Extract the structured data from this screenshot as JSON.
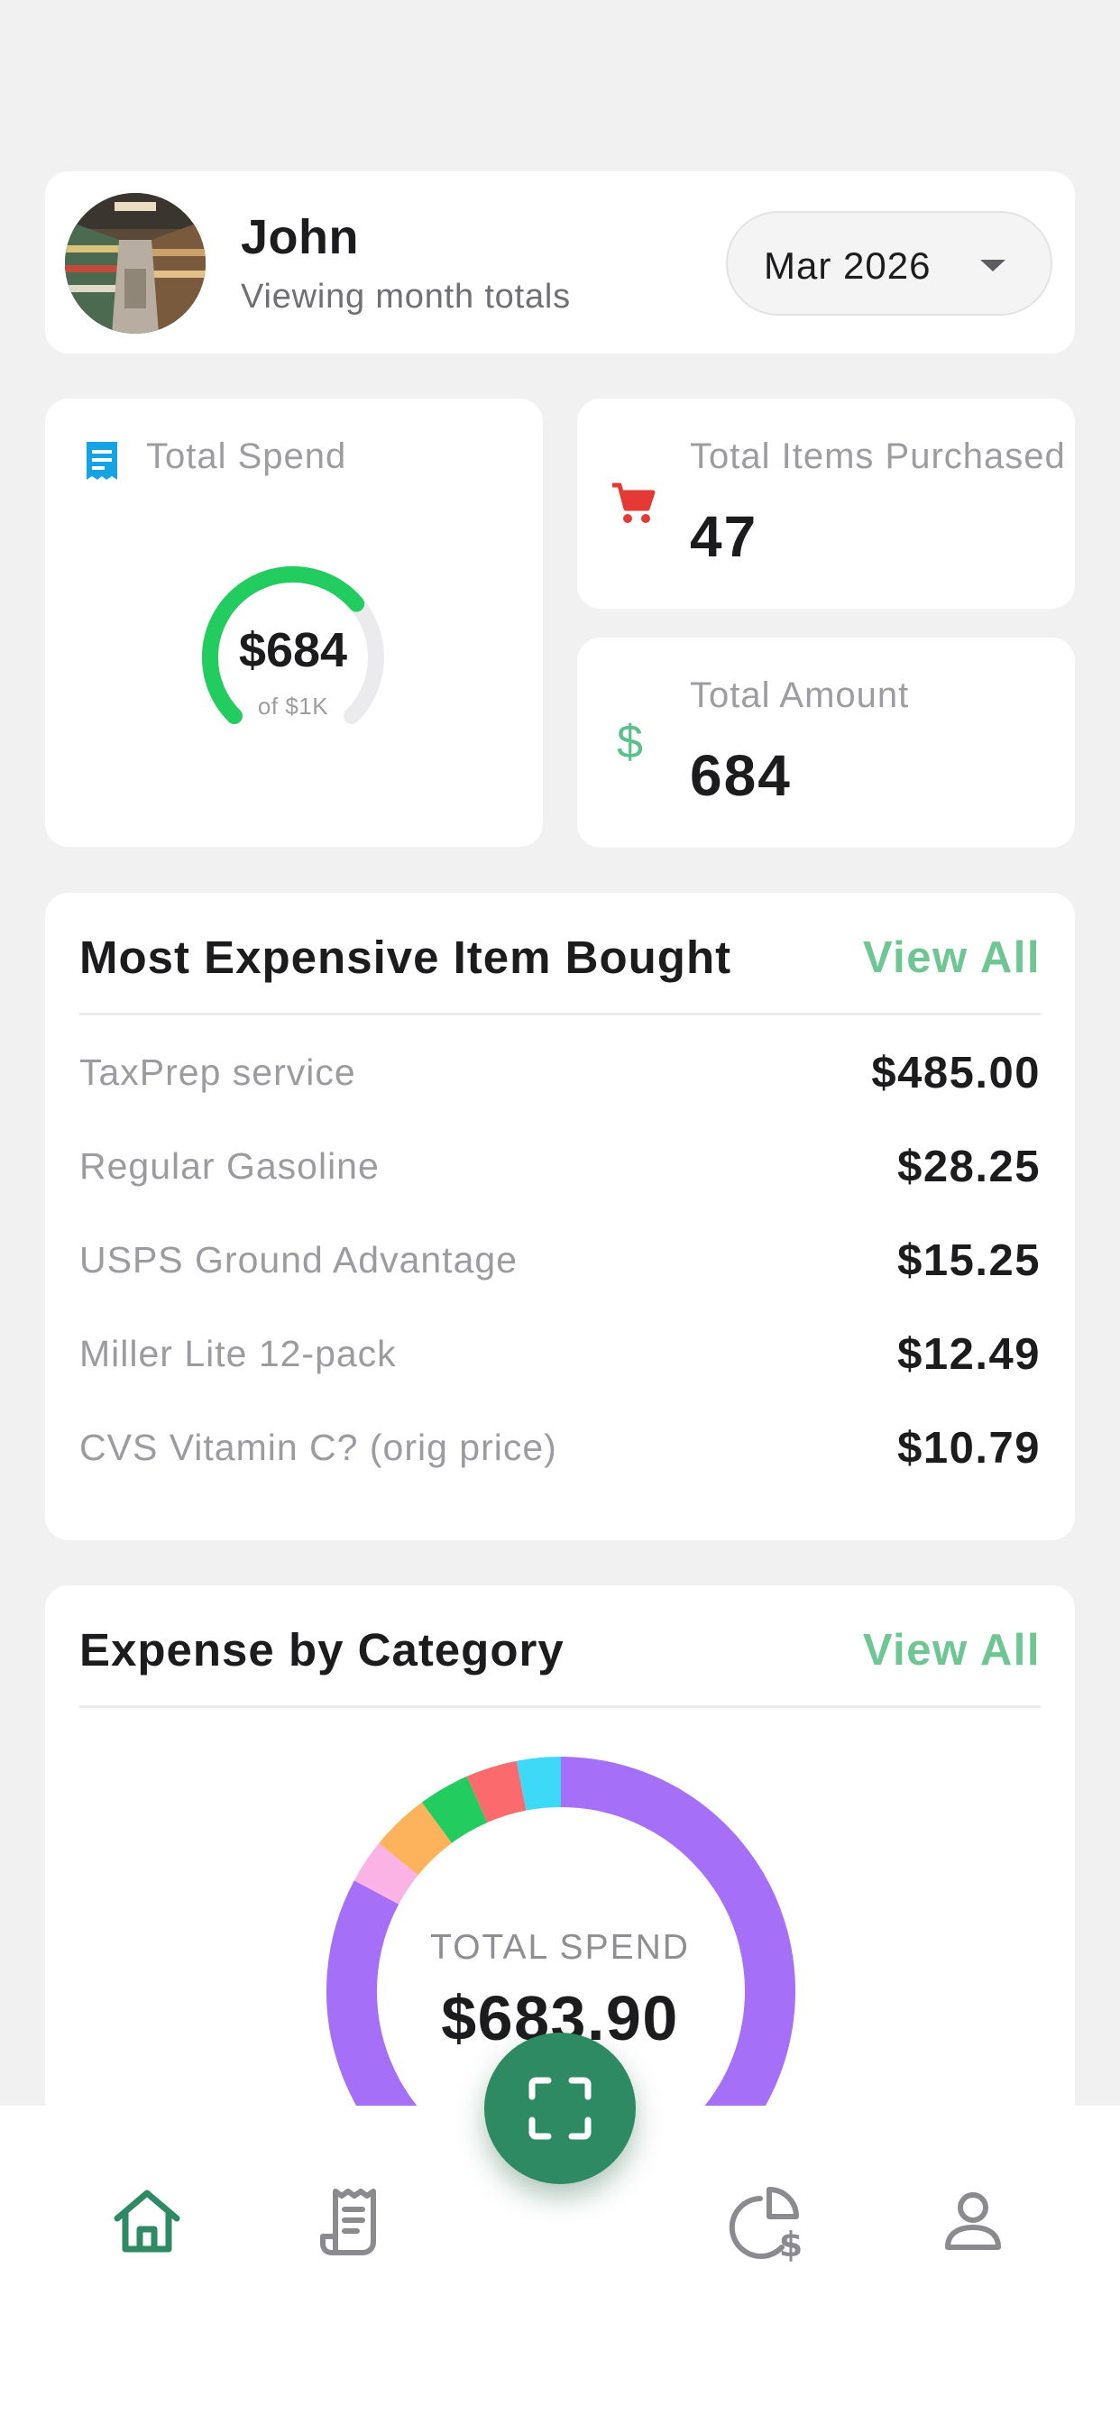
{
  "profile": {
    "name": "John",
    "subtitle": "Viewing month totals",
    "month_label": "Mar 2026"
  },
  "total_spend": {
    "title": "Total Spend",
    "amount": "$684",
    "limit_label": "of $1K",
    "progress_fraction": 0.684
  },
  "stats": {
    "items_label": "Total Items Purchased",
    "items_value": "47",
    "amount_label": "Total Amount",
    "amount_value": "684",
    "dollar_glyph": "$"
  },
  "most_expensive": {
    "title": "Most Expensive Item Bought",
    "view_all": "View All",
    "items": [
      {
        "name": "TaxPrep service",
        "price": "$485.00"
      },
      {
        "name": "Regular Gasoline",
        "price": "$28.25"
      },
      {
        "name": "USPS Ground Advantage",
        "price": "$15.25"
      },
      {
        "name": "Miller Lite 12-pack",
        "price": "$12.49"
      },
      {
        "name": "CVS Vitamin C? (orig price)",
        "price": "$10.79"
      }
    ]
  },
  "expense_by_category": {
    "title": "Expense by Category",
    "view_all": "View All",
    "caption": "TOTAL SPEND",
    "total": "$683.90"
  },
  "chart_data": {
    "type": "pie",
    "donut": true,
    "title": "",
    "categories": [
      "",
      "",
      "",
      "",
      "",
      ""
    ],
    "values": [
      0.82,
      0.03,
      0.04,
      0.035,
      0.035,
      0.03
    ],
    "colors": [
      "#a56ff7",
      "#fbb3e5",
      "#fcb35b",
      "#22cc5e",
      "#fb6b6e",
      "#3ed9f7"
    ]
  },
  "colors": {
    "accent_green": "#2e8a62",
    "link_green": "#6ec693",
    "gauge_green": "#22cc5e",
    "cart_red": "#e43a36",
    "receipt_blue": "#16a3e6"
  },
  "nav": {
    "items": [
      "home-icon",
      "receipt-icon",
      "chart-dollar-icon",
      "user-icon"
    ],
    "scan_icon": "scan-frame-icon"
  }
}
